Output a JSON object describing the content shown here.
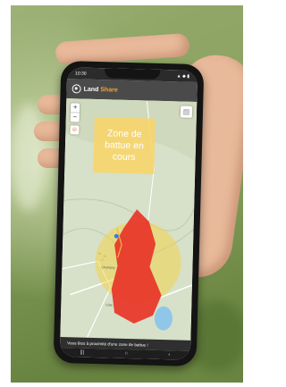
{
  "status_bar": {
    "time": "10:30",
    "indicators": "▲ ◆ ▮"
  },
  "app": {
    "logo_text_main": "Land",
    "logo_text_accent": "Share"
  },
  "map": {
    "zoom_in": "+",
    "zoom_out": "−",
    "locate_icon": "locate-icon",
    "layers_icon": "layers-icon",
    "zone_banner": "Zone de battue en cours",
    "place_label_1": "Champey",
    "place_label_2": "Côte",
    "colors": {
      "danger": "#e8392b",
      "warning": "#f2d34a",
      "banner": "#f7d56c",
      "lake": "#8fc7e8"
    }
  },
  "alert": {
    "text": "Vous êtes à proximité d'une zone de battue !"
  },
  "nav": {
    "menu": "|||",
    "home": "○",
    "back": "‹"
  }
}
